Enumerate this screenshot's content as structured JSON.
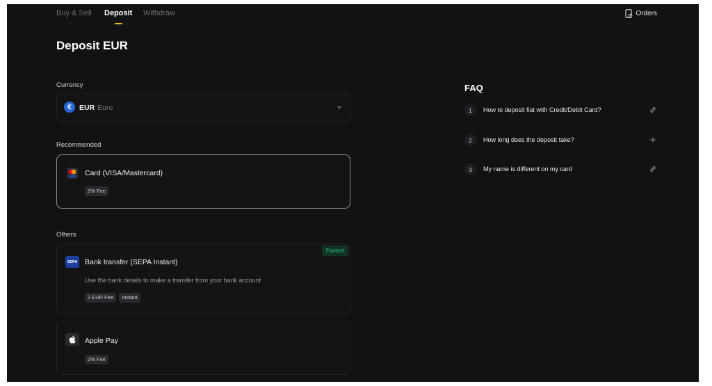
{
  "nav": {
    "tabs": [
      {
        "label": "Buy & Sell"
      },
      {
        "label": "Deposit"
      },
      {
        "label": "Withdraw"
      }
    ],
    "active_tab": "Deposit",
    "orders_label": "Orders"
  },
  "page": {
    "title": "Deposit EUR"
  },
  "currency": {
    "label": "Currency",
    "code": "EUR",
    "name": "Euro",
    "symbol": "€"
  },
  "recommended": {
    "label": "Recommended",
    "method": {
      "title": "Card (VISA/Mastercard)",
      "tags": [
        "2% Fee"
      ],
      "icon": "credit-card-icon"
    }
  },
  "others": {
    "label": "Others",
    "methods": [
      {
        "title": "Bank transfer (SEPA Instant)",
        "description": "Use the bank details to make a transfer from your bank account",
        "tags": [
          "1 EUR Fee",
          "Instant"
        ],
        "badge": "Fastest",
        "icon": "sepa-icon",
        "icon_text": "SEPA"
      },
      {
        "title": "Apple Pay",
        "tags": [
          "2% Fee"
        ],
        "icon": "apple-icon"
      }
    ]
  },
  "faq": {
    "title": "FAQ",
    "items": [
      {
        "num": "1",
        "text": "How to deposit fiat with Credit/Debit Card?",
        "action": "link-icon"
      },
      {
        "num": "2",
        "text": "How long does the deposit take?",
        "action": "plus-icon"
      },
      {
        "num": "3",
        "text": "My name is different on my card",
        "action": "link-icon"
      }
    ]
  },
  "colors": {
    "background": "#121214",
    "accent": "#f0b90b",
    "fastest": "#2fbf7a",
    "eur_coin": "#2a6bd8"
  }
}
